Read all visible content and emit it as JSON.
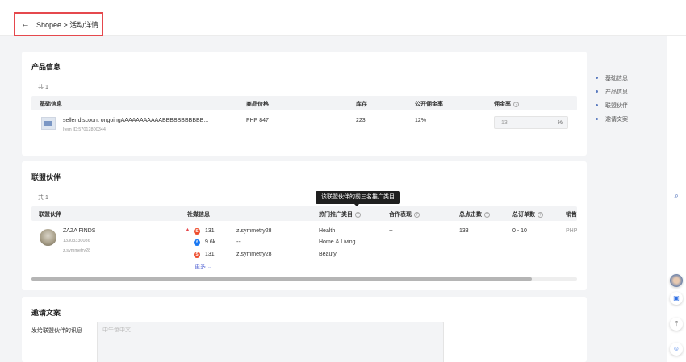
{
  "header": {
    "back_icon": "←",
    "breadcrumb": "Shopee > 活动详情"
  },
  "product": {
    "title": "产品信息",
    "count": "共 1",
    "columns": {
      "basic": "基础信息",
      "price": "商品价格",
      "stock": "库存",
      "public_rate": "公开佣金率",
      "rate": "佣金率"
    },
    "rows": [
      {
        "name": "seller discount ongoingAAAAAAAAAAABBBBBBBBBBB...",
        "item_id": "Item ID:57012800344",
        "price": "PHP 847",
        "stock": "223",
        "public_rate": "12%",
        "rate_placeholder": "13",
        "rate_unit": "%"
      }
    ]
  },
  "affiliate": {
    "title": "联盟伙伴",
    "count": "共 1",
    "columns": {
      "partner": "联盟伙伴",
      "social": "社媒信息",
      "hot_cat": "热门推广类目",
      "performance": "合作表现",
      "clicks": "总点击数",
      "orders": "总订单数",
      "sales": "销售"
    },
    "tooltip": "该联盟伙伴的前三名推广类目",
    "rows": [
      {
        "name": "ZAZA FINDS",
        "phone": "13303330086",
        "handle": "z.symmetry28",
        "social": [
          {
            "platform": "shopee",
            "count": "131",
            "handle": "z.symmetry28"
          },
          {
            "platform": "facebook",
            "count": "9.6k",
            "handle": "--"
          },
          {
            "platform": "shopee",
            "count": "131",
            "handle": "z.symmetry28"
          }
        ],
        "more": "更多",
        "categories": [
          "Health",
          "Home & Living",
          "Beauty"
        ],
        "performance": "--",
        "clicks": "133",
        "orders": "0 - 10",
        "sales": "PHP"
      }
    ]
  },
  "invite": {
    "title": "邀请文案",
    "label": "发给联盟伙伴的讯息",
    "placeholder": "中午傻中文"
  },
  "anchor_nav": [
    "基础信息",
    "产品信息",
    "联盟伙伴",
    "邀请文案"
  ],
  "colors": {
    "highlight_border": "#e5484d",
    "shopee": "#ee4d2d",
    "facebook": "#1877f2",
    "accent": "#5b7bbf"
  }
}
